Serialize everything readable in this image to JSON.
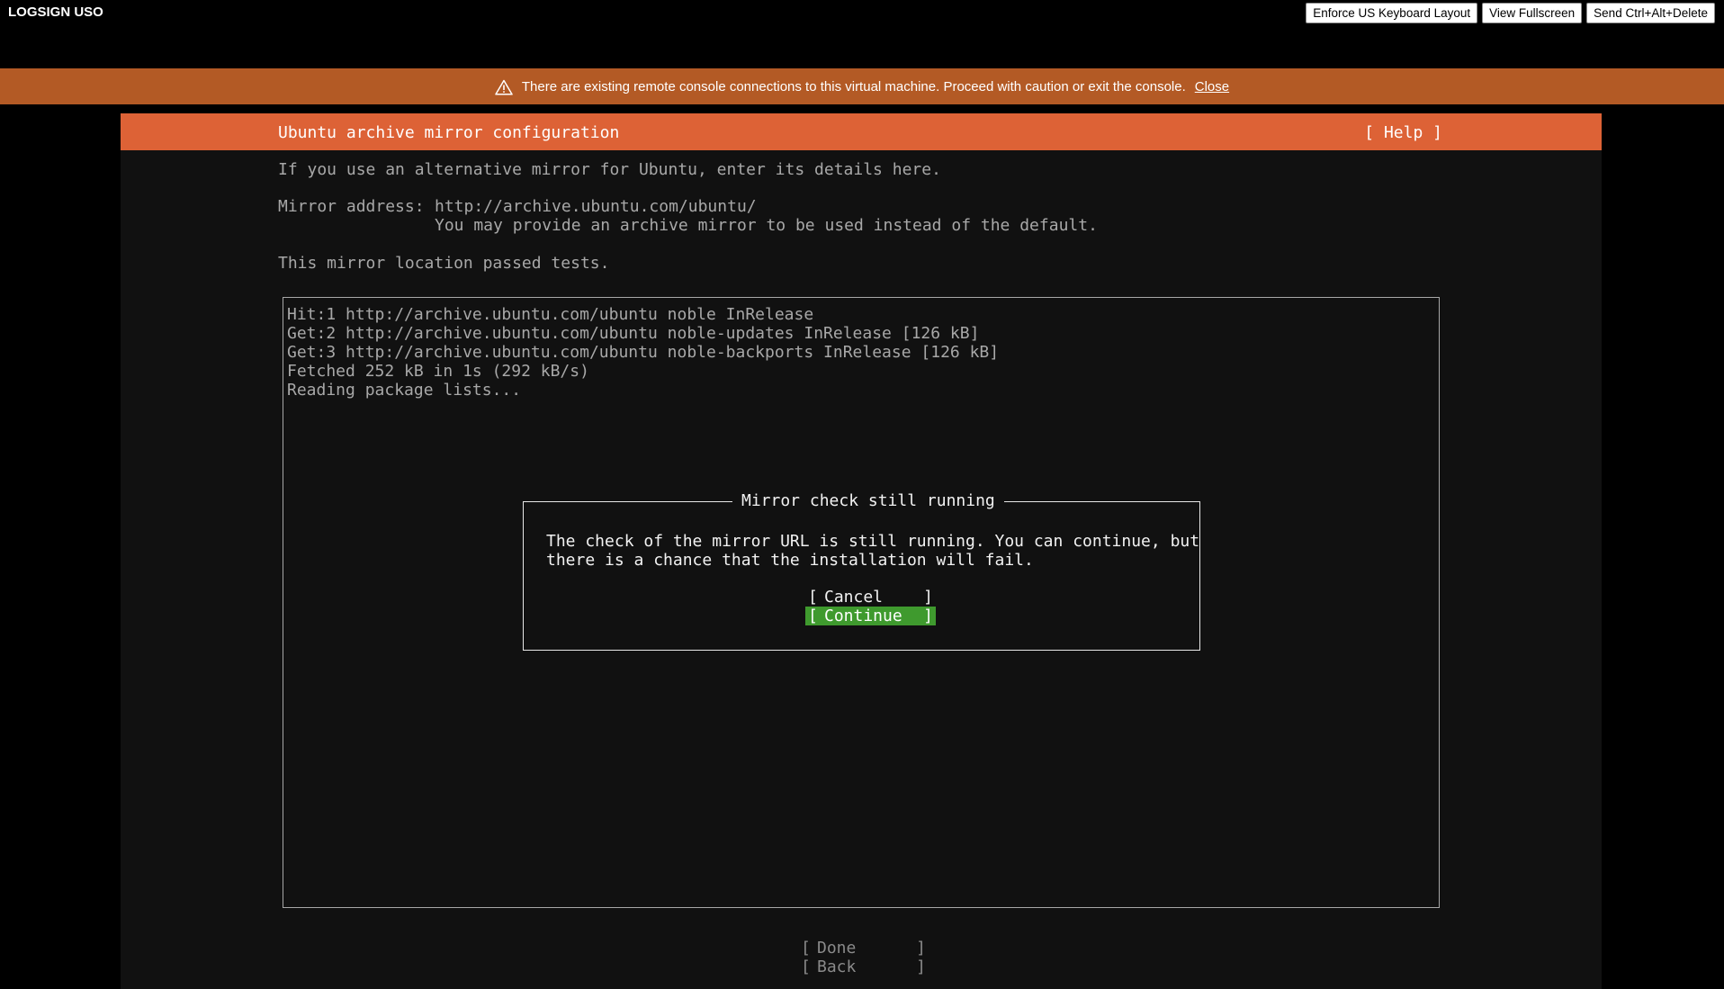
{
  "topbar": {
    "title": "LOGSIGN USO",
    "buttons": [
      "Enforce US Keyboard Layout",
      "View Fullscreen",
      "Send Ctrl+Alt+Delete"
    ]
  },
  "banner": {
    "icon": "warning-triangle-icon",
    "message": "There are existing remote console connections to this virtual machine. Proceed with caution or exit the console.",
    "close_label": "Close",
    "color": "#b35a25"
  },
  "screen": {
    "header_title": "Ubuntu archive mirror configuration",
    "help_label": "[ Help ]",
    "header_color": "#dd6236",
    "intro": "If you use an alternative mirror for Ubuntu, enter its details here.",
    "mirror_label": "Mirror address:",
    "mirror_value": "http://archive.ubuntu.com/ubuntu/",
    "mirror_hint": "You may provide an archive mirror to be used instead of the default.",
    "status": "This mirror location passed tests.",
    "log": [
      "Hit:1 http://archive.ubuntu.com/ubuntu noble InRelease",
      "Get:2 http://archive.ubuntu.com/ubuntu noble-updates InRelease [126 kB]",
      "Get:3 http://archive.ubuntu.com/ubuntu noble-backports InRelease [126 kB]",
      "Fetched 252 kB in 1s (292 kB/s)",
      "Reading package lists..."
    ]
  },
  "dialog": {
    "title": "Mirror check still running",
    "lines": [
      "The check of the mirror URL is still running. You can continue, but",
      "there is a chance that the installation will fail."
    ],
    "cancel_label": "Cancel",
    "continue_label": "Continue",
    "focus_color": "#3f9a2e"
  },
  "footer": {
    "done_label": "Done",
    "back_label": "Back"
  }
}
